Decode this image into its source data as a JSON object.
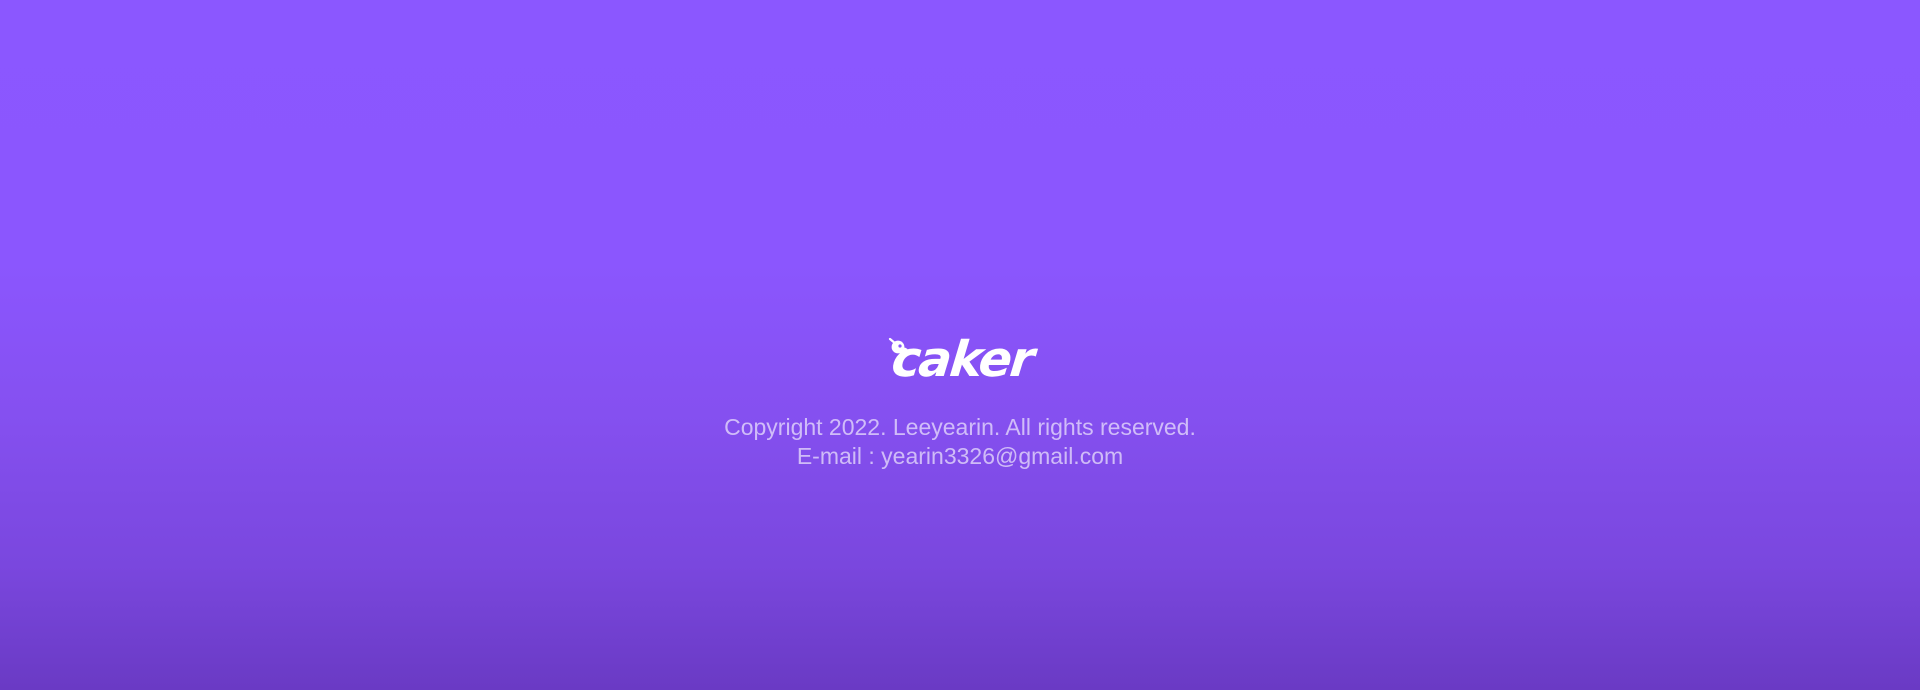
{
  "footer": {
    "logo_text": "caker",
    "logo_icon": "cupcake-icon",
    "copyright": "Copyright 2022. Leeyearin. All rights reserved.",
    "email": "E-mail : yearin3326@gmail.com"
  },
  "colors": {
    "background_top": "#8b57ff",
    "background_bottom": "#6a3ac4",
    "logo": "#ffffff",
    "text": "#d3c3f5"
  }
}
